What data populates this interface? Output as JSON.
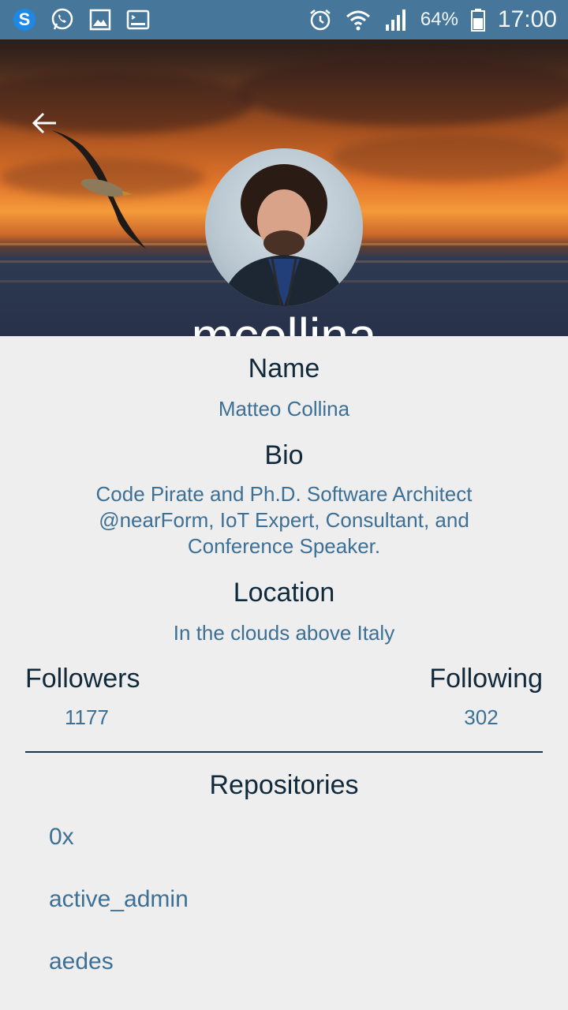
{
  "status_bar": {
    "battery": "64%",
    "time": "17:00",
    "icons": [
      "skype-icon",
      "whatsapp-icon",
      "gallery-icon",
      "terminal-icon",
      "alarm-icon",
      "wifi-icon",
      "signal-icon",
      "battery-icon"
    ]
  },
  "header": {
    "username": "mcollina",
    "back_icon": "arrow-left-icon"
  },
  "profile": {
    "name_label": "Name",
    "name_value": "Matteo Collina",
    "bio_label": "Bio",
    "bio_lines": [
      "Code Pirate and Ph.D. Software Architect",
      "@nearForm, IoT Expert, Consultant, and",
      "Conference Speaker."
    ],
    "location_label": "Location",
    "location_value": "In the clouds above Italy",
    "followers_label": "Followers",
    "followers_value": "1177",
    "following_label": "Following",
    "following_value": "302"
  },
  "repositories": {
    "title": "Repositories",
    "items": [
      "0x",
      "active_admin",
      "aedes"
    ]
  },
  "colors": {
    "status_bar": "#46779a",
    "label": "#10293b",
    "value": "#3d7096",
    "background": "#eeeeee"
  }
}
